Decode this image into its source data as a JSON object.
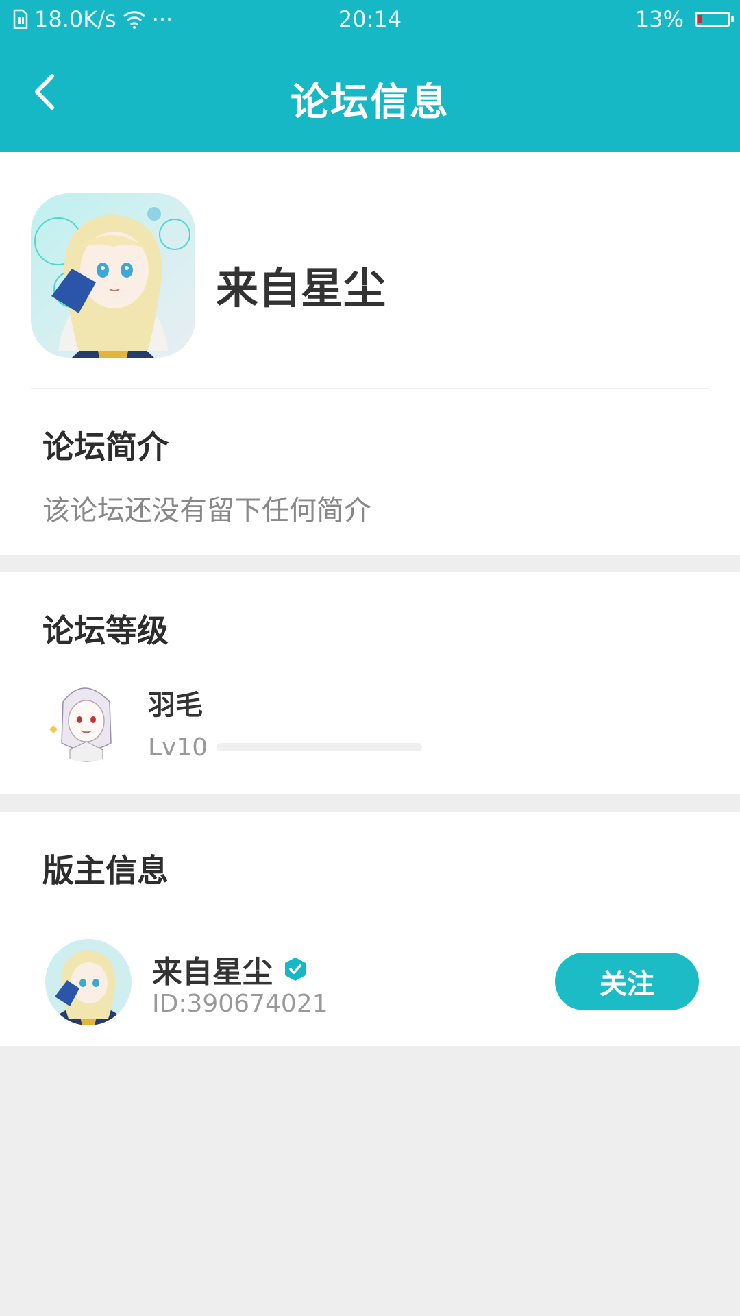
{
  "status_bar": {
    "speed": "18.0K/s",
    "more": "···",
    "time": "20:14",
    "battery": "13%",
    "battery_level": 0.13,
    "icons": [
      "sim-card-icon",
      "wifi-icon",
      "battery-icon"
    ]
  },
  "header": {
    "title": "论坛信息",
    "back_icon": "chevron-left-icon"
  },
  "forum": {
    "name": "来自星尘",
    "avatar": "anime-girl-avatar"
  },
  "intro": {
    "title": "论坛简介",
    "text": "该论坛还没有留下任何简介"
  },
  "level": {
    "title": "论坛等级",
    "name": "羽毛",
    "lv": "Lv10",
    "progress": 0
  },
  "moderator": {
    "title": "版主信息",
    "name": "来自星尘",
    "id": "ID:390674021",
    "verified_icon": "verified-badge-icon",
    "follow_label": "关注"
  },
  "colors": {
    "accent": "#17b8c6",
    "background": "#eeeeee",
    "battery_low": "#e5212c"
  }
}
